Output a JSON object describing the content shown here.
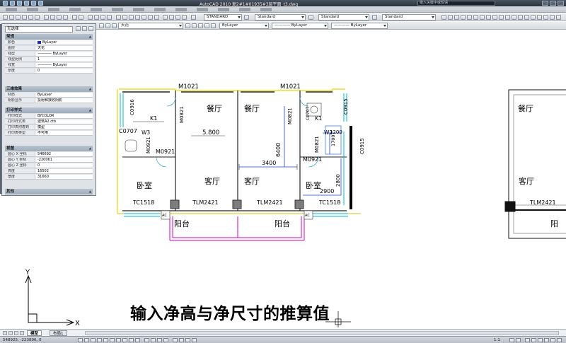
{
  "window": {
    "title": "AutoCAD 2010    复2#1#01935#3层平面_t3.dwg",
    "search_placeholder": "键入关键字或短语"
  },
  "toolbar": {
    "layer_combo": "天花",
    "textstyle_combo": "STANDARD",
    "dimstyle_combo": "Standard",
    "tablestyle_combo": "Standard",
    "multileader_combo": "Standard",
    "color_combo": "ByLayer",
    "linetype_combo": "———— ByLayer",
    "lineweight_combo": "———— ByLayer"
  },
  "properties": {
    "selection_combo": "无选择",
    "sections": [
      {
        "title": "常规",
        "rows": [
          {
            "key": "颜色",
            "value": "ByLayer",
            "swatch": true
          },
          {
            "key": "图层",
            "value": "天花"
          },
          {
            "key": "线型",
            "value": "———— ByLayer"
          },
          {
            "key": "线型比例",
            "value": "1"
          },
          {
            "key": "线宽",
            "value": "———— ByLayer"
          },
          {
            "key": "厚度",
            "value": "0"
          }
        ]
      },
      {
        "title": "三维效果",
        "rows": [
          {
            "key": "材质",
            "value": "ByLayer"
          },
          {
            "key": "阴影显示",
            "value": "投射和接收阴影"
          }
        ]
      },
      {
        "title": "打印样式",
        "rows": [
          {
            "key": "打印样式",
            "value": "BYCOLOR"
          },
          {
            "key": "打印样式表",
            "value": "建筑A2.ctb"
          },
          {
            "key": "打印表附着到",
            "value": "模型"
          },
          {
            "key": "打印表类型",
            "value": "不可用"
          }
        ]
      },
      {
        "title": "视图",
        "rows": [
          {
            "key": "圆心 X 坐标",
            "value": "546692"
          },
          {
            "key": "圆心 Y 坐标",
            "value": "-220061"
          },
          {
            "key": "圆心 Z 坐标",
            "value": "0"
          },
          {
            "key": "高度",
            "value": "16502"
          },
          {
            "key": "宽度",
            "value": "31660"
          }
        ]
      },
      {
        "title": "其他",
        "rows": []
      }
    ]
  },
  "drawing": {
    "labels": {
      "m1021_left": "M1021",
      "m1021_right": "M1021",
      "c0916": "C0916",
      "k1_left": "K1",
      "k1_right": "K1",
      "m0821_tl": "M0821",
      "m0821_tr": "M0821",
      "m0821_br": "M0821",
      "c0707": "C0707",
      "c0707_right": "C0707",
      "w3_left": "W3",
      "w3_right": "W3",
      "m0921_left": "M0921",
      "m0921_right": "M0921",
      "c0915_top": "C0915",
      "c0915_right": "C0915",
      "dining_left": "餐厅",
      "dining_right": "餐厅",
      "dining_far": "餐厅",
      "living_left": "客厅",
      "living_right": "客厅",
      "living_far": "客厅",
      "bedroom_left": "卧室",
      "bedroom_right": "卧室",
      "balcony_left": "阳台",
      "balcony_right": "阳台",
      "balcony_far": "阳",
      "tc1518_left": "TC1518",
      "tc1518_right": "TC1518",
      "tlm2421_left": "TLM2421",
      "tlm2421_right": "TLM2421",
      "tlm2421_far": "TLM2421",
      "dim_5800": "5.800",
      "dim_3400": "3400",
      "dim_6400": "6400",
      "dim_2900": "2900",
      "dim_2800": "2800",
      "dim_1200": "1200",
      "dim_1700": "1700",
      "ac_left": "AC",
      "ac_right": "AC"
    }
  },
  "caption": "输入净高与净尺寸的推算值",
  "ucs": {
    "x_label": "X",
    "y_label": "Y"
  },
  "tabs": {
    "model": "模型",
    "layout": "布局1"
  },
  "status": {
    "coords": "548925, -223896, 0",
    "scale": "1:1"
  }
}
